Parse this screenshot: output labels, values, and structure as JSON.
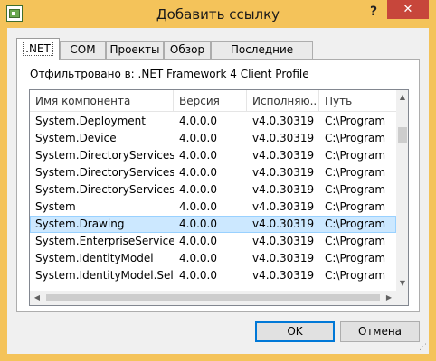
{
  "window": {
    "title": "Добавить ссылку",
    "help_label": "?",
    "close_label": "✕",
    "accent_color": "#f4c35a"
  },
  "tabs": [
    {
      "label": ".NET",
      "active": true
    },
    {
      "label": "COM",
      "active": false
    },
    {
      "label": "Проекты",
      "active": false
    },
    {
      "label": "Обзор",
      "active": false
    },
    {
      "label": "Последние файлы",
      "active": false
    }
  ],
  "filter_label": "Отфильтровано в: .NET Framework 4 Client Profile",
  "list": {
    "columns": [
      "Имя компонента",
      "Версия",
      "Исполняю...",
      "Путь"
    ],
    "rows": [
      {
        "name": "System.Deployment",
        "version": "4.0.0.0",
        "runtime": "v4.0.30319",
        "path": "C:\\Program"
      },
      {
        "name": "System.Device",
        "version": "4.0.0.0",
        "runtime": "v4.0.30319",
        "path": "C:\\Program"
      },
      {
        "name": "System.DirectoryServices....",
        "version": "4.0.0.0",
        "runtime": "v4.0.30319",
        "path": "C:\\Program"
      },
      {
        "name": "System.DirectoryServices",
        "version": "4.0.0.0",
        "runtime": "v4.0.30319",
        "path": "C:\\Program"
      },
      {
        "name": "System.DirectoryServices.P...",
        "version": "4.0.0.0",
        "runtime": "v4.0.30319",
        "path": "C:\\Program"
      },
      {
        "name": "System",
        "version": "4.0.0.0",
        "runtime": "v4.0.30319",
        "path": "C:\\Program"
      },
      {
        "name": "System.Drawing",
        "version": "4.0.0.0",
        "runtime": "v4.0.30319",
        "path": "C:\\Program",
        "selected": true
      },
      {
        "name": "System.EnterpriseServices",
        "version": "4.0.0.0",
        "runtime": "v4.0.30319",
        "path": "C:\\Program"
      },
      {
        "name": "System.IdentityModel",
        "version": "4.0.0.0",
        "runtime": "v4.0.30319",
        "path": "C:\\Program"
      },
      {
        "name": "System.IdentityModel.Sele...",
        "version": "4.0.0.0",
        "runtime": "v4.0.30319",
        "path": "C:\\Program"
      }
    ],
    "selection_color": "#cce8ff"
  },
  "scrollbar": {
    "up_icon": "▲",
    "down_icon": "▼",
    "left_icon": "◀",
    "right_icon": "▶"
  },
  "buttons": {
    "ok_label": "OK",
    "cancel_label": "Отмена"
  }
}
